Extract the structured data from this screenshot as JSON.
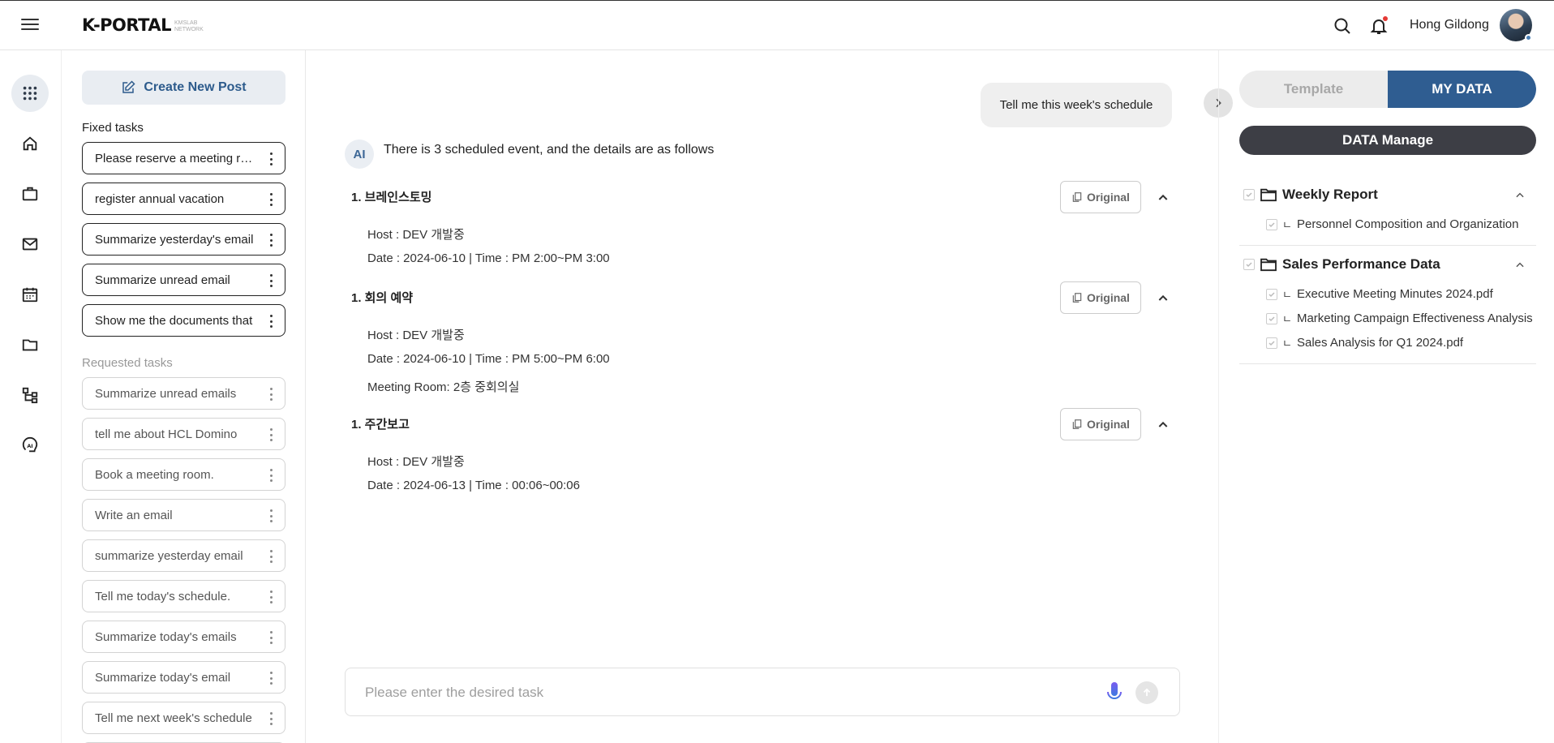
{
  "header": {
    "logo": "K-PORTAL",
    "logo_sub": "KMSLAB NETWORK",
    "user_name": "Hong Gildong"
  },
  "rail": {
    "items": [
      "apps-grid-icon",
      "home-icon",
      "briefcase-icon",
      "mail-icon",
      "calendar-icon",
      "folder-icon",
      "org-chart-icon",
      "ai-assistant-icon"
    ]
  },
  "tasks": {
    "create_label": "Create New Post",
    "fixed_label": "Fixed tasks",
    "fixed": [
      "Please reserve a meeting room",
      "register annual vacation",
      "Summarize yesterday's email",
      "Summarize unread email",
      "Show me the documents that"
    ],
    "requested_label": "Requested tasks",
    "requested": [
      "Summarize unread emails",
      "tell me about HCL Domino",
      "Book a meeting room.",
      "Write an email",
      "summarize yesterday email",
      "Tell me today's schedule.",
      "Summarize today's emails",
      "Summarize today's email",
      "Tell me next week's schedule"
    ]
  },
  "chat": {
    "user_message": "Tell me this week's schedule",
    "ai_avatar": "AI",
    "ai_intro": "There is 3 scheduled event, and the details are as follows",
    "original_label": "Original",
    "events": [
      {
        "title": "1. 브레인스토밍",
        "host": "Host : DEV 개발중",
        "date": "Date : 2024-06-10 | Time : PM 2:00~PM 3:00"
      },
      {
        "title": "1. 회의 예약",
        "host": "Host : DEV 개발중",
        "date": "Date : 2024-06-10 | Time : PM 5:00~PM 6:00",
        "room": "Meeting Room: 2층 중회의실"
      },
      {
        "title": "1. 주간보고",
        "host": "Host : DEV 개발중",
        "date": "Date : 2024-06-13 | Time : 00:06~00:06"
      }
    ],
    "input_placeholder": "Please enter the desired task"
  },
  "right_panel": {
    "tab_template": "Template",
    "tab_mydata": "MY DATA",
    "active_tab": "MY DATA",
    "data_manage": "DATA Manage",
    "folders": [
      {
        "name": "Weekly Report",
        "files": [
          "Personnel Composition and Organization"
        ]
      },
      {
        "name": "Sales Performance Data",
        "files": [
          "Executive Meeting Minutes 2024.pdf",
          "Marketing Campaign Effectiveness Analysis",
          "Sales Analysis for Q1 2024.pdf"
        ]
      }
    ]
  },
  "colors": {
    "accent": "#2f5d91",
    "dark_button": "#3d3e45",
    "notification_dot": "#e53935"
  }
}
